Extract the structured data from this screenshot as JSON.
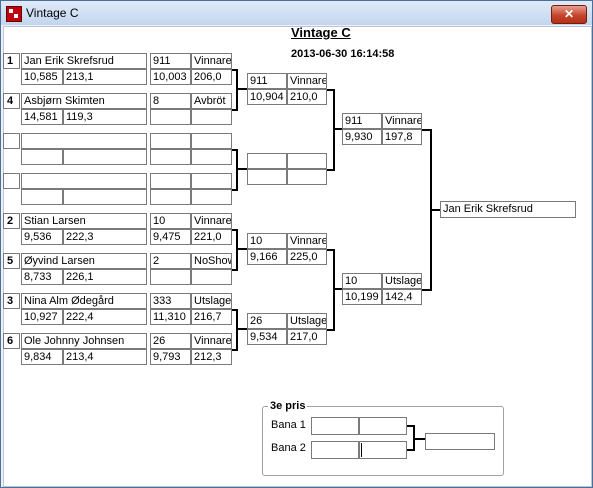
{
  "window": {
    "title": "Vintage C"
  },
  "header": {
    "title": "Vintage C",
    "timestamp": "2013-06-30 16:14:58"
  },
  "round1": [
    {
      "seed": "1",
      "name": "Jan Erik Skrefsrud",
      "time": "10,585",
      "speed": "213,1"
    },
    {
      "seed": "4",
      "name": "Asbjørn Skimten",
      "time": "14,581",
      "speed": "119,3"
    },
    {
      "seed": "",
      "name": "",
      "time": "",
      "speed": ""
    },
    {
      "seed": "",
      "name": "",
      "time": "",
      "speed": ""
    },
    {
      "seed": "2",
      "name": "Stian Larsen",
      "time": "9,536",
      "speed": "222,3"
    },
    {
      "seed": "5",
      "name": "Øyvind Larsen",
      "time": "8,733",
      "speed": "226,1"
    },
    {
      "seed": "3",
      "name": "Nina Alm Ødegård",
      "time": "10,927",
      "speed": "222,4"
    },
    {
      "seed": "6",
      "name": "Ole Johnny Johnsen",
      "time": "9,834",
      "speed": "213,4"
    }
  ],
  "round2": [
    {
      "no": "911",
      "result": "Vinnare",
      "time": "10,003",
      "speed": "206,0"
    },
    {
      "no": "8",
      "result": "Avbröt",
      "time": "",
      "speed": ""
    },
    {
      "no": "",
      "result": "",
      "time": "",
      "speed": ""
    },
    {
      "no": "",
      "result": "",
      "time": "",
      "speed": ""
    },
    {
      "no": "10",
      "result": "Vinnare",
      "time": "9,475",
      "speed": "221,0"
    },
    {
      "no": "2",
      "result": "NoShow",
      "time": "",
      "speed": ""
    },
    {
      "no": "333",
      "result": "Utslager",
      "time": "11,310",
      "speed": "216,7"
    },
    {
      "no": "26",
      "result": "Vinnare",
      "time": "9,793",
      "speed": "212,3"
    }
  ],
  "round3": [
    {
      "no": "911",
      "result": "Vinnare",
      "time": "10,904",
      "speed": "210,0"
    },
    {
      "no": "",
      "result": "",
      "time": "",
      "speed": ""
    },
    {
      "no": "10",
      "result": "Vinnare",
      "time": "9,166",
      "speed": "225,0"
    },
    {
      "no": "26",
      "result": "Utslager",
      "time": "9,534",
      "speed": "217,0"
    }
  ],
  "round4": [
    {
      "no": "911",
      "result": "Vinnare",
      "time": "9,930",
      "speed": "197,8"
    },
    {
      "no": "10",
      "result": "Utslager",
      "time": "10,199",
      "speed": "142,4"
    }
  ],
  "winner": "Jan Erik Skrefsrud",
  "third_place": {
    "title": "3e pris",
    "lanes": [
      {
        "label": "Bana 1",
        "a": "",
        "b": ""
      },
      {
        "label": "Bana 2",
        "a": "",
        "b": ""
      }
    ],
    "result": ""
  }
}
